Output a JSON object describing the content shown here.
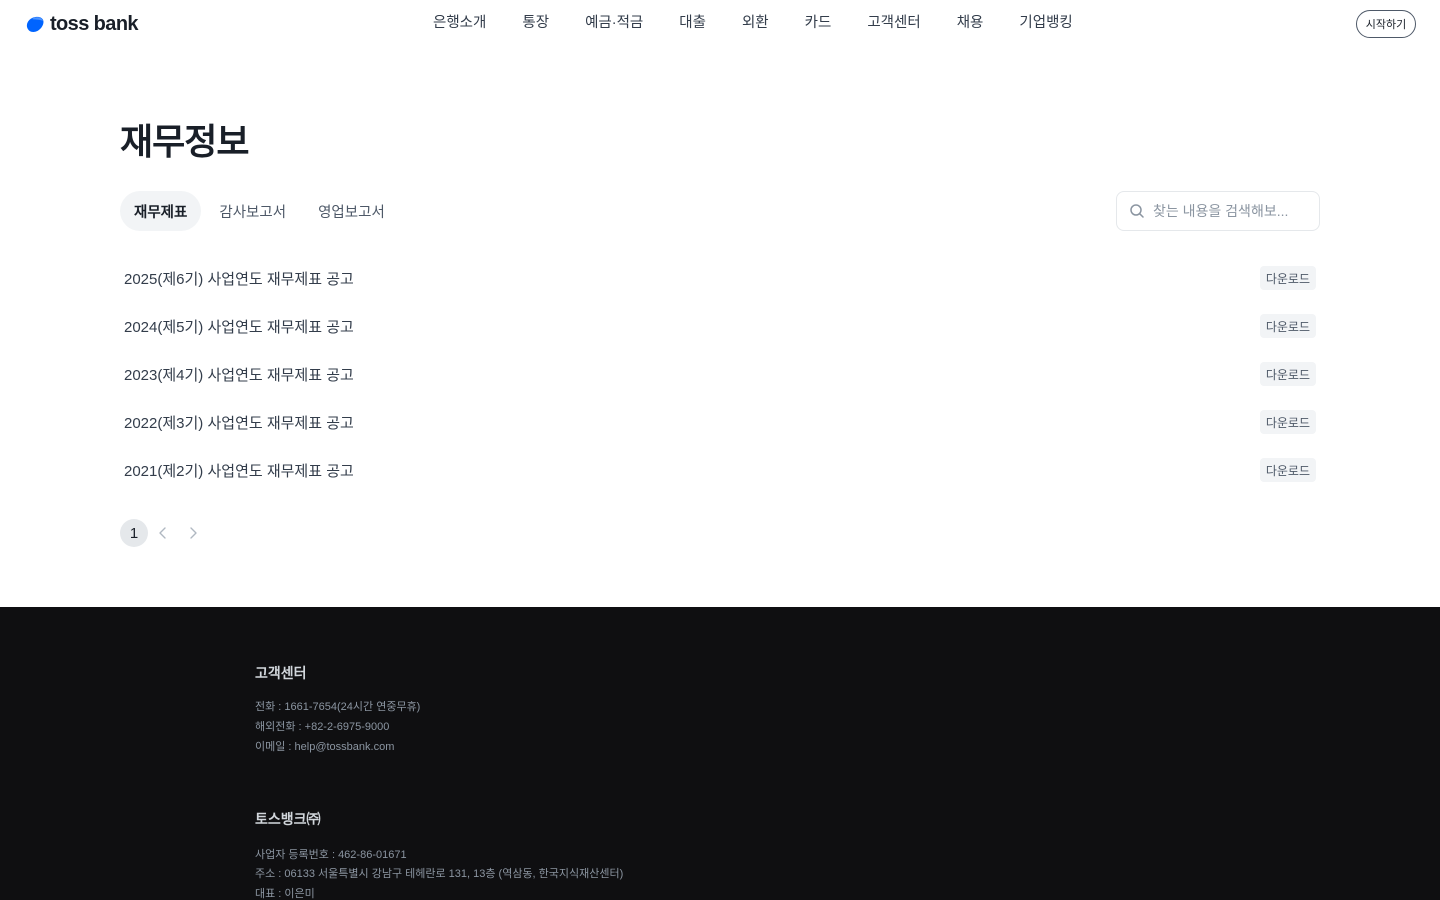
{
  "header": {
    "logo_text": "toss bank",
    "nav": [
      "은행소개",
      "통장",
      "예금·적금",
      "대출",
      "외환",
      "카드",
      "고객센터",
      "채용",
      "기업뱅킹"
    ],
    "start_label": "시작하기"
  },
  "main": {
    "title": "재무정보",
    "tabs": [
      "재무제표",
      "감사보고서",
      "영업보고서"
    ],
    "active_tab": "재무제표",
    "search_placeholder": "찾는 내용을 검색해보...",
    "rows": [
      {
        "title": "2025(제6기) 사업연도 재무제표 공고",
        "action": "다운로드"
      },
      {
        "title": "2024(제5기) 사업연도 재무제표 공고",
        "action": "다운로드"
      },
      {
        "title": "2023(제4기) 사업연도 재무제표 공고",
        "action": "다운로드"
      },
      {
        "title": "2022(제3기) 사업연도 재무제표 공고",
        "action": "다운로드"
      },
      {
        "title": "2021(제2기) 사업연도 재무제표 공고",
        "action": "다운로드"
      }
    ],
    "pagination": {
      "current": "1"
    }
  },
  "footer": {
    "support_heading": "고객센터",
    "support_lines": [
      "전화 : 1661-7654(24시간 연중무휴)",
      "해외전화 : +82-2-6975-9000",
      "이메일 : help@tossbank.com"
    ],
    "company_heading": "토스뱅크㈜",
    "company_lines": [
      "사업자 등록번호 : 462-86-01671",
      "주소 : 06133 서울특별시 강남구 테헤란로 131, 13층 (역삼동, 한국지식재산센터)",
      "대표 : 이은미"
    ]
  },
  "colors": {
    "brand_blue": "#0064ff",
    "text": "#191f28",
    "footer_bg": "#0f0f11"
  }
}
